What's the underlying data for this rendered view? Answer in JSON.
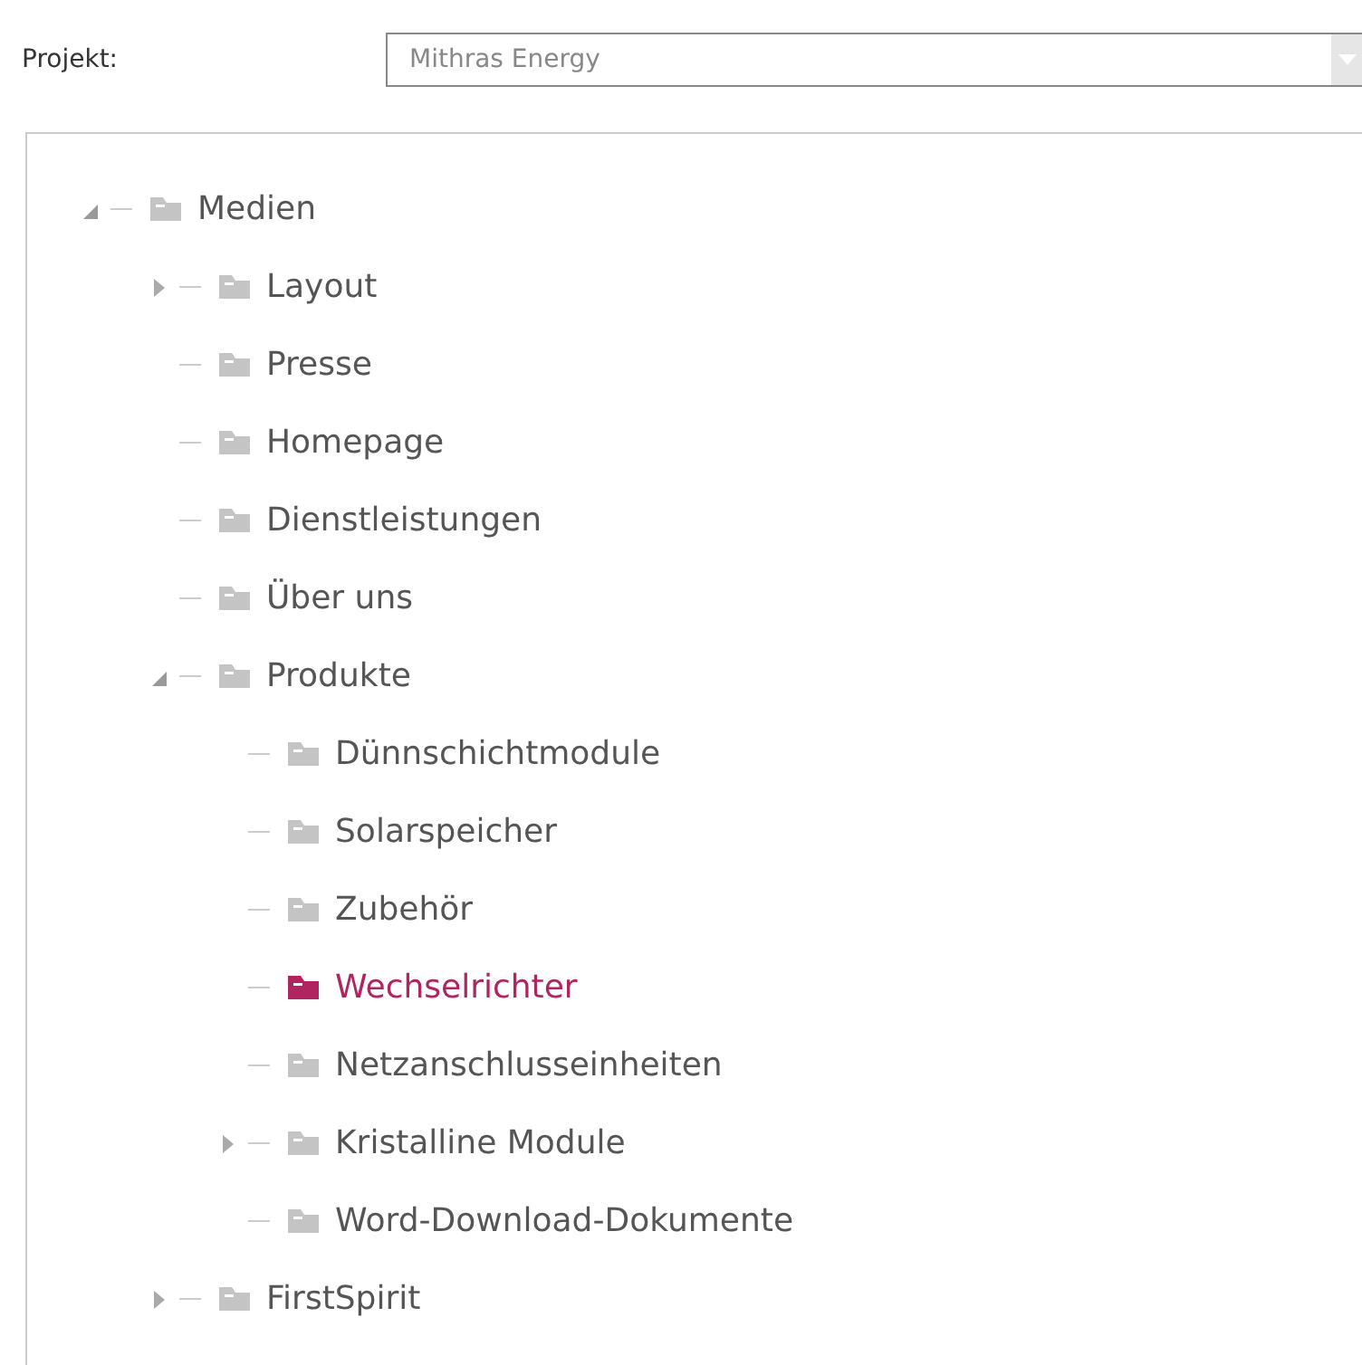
{
  "project": {
    "label": "Projekt:",
    "value": "Mithras Energy"
  },
  "tree": [
    {
      "label": "Medien",
      "expanded": true,
      "selected": false,
      "children": [
        {
          "label": "Layout",
          "expanded": false,
          "selected": false
        },
        {
          "label": "Presse",
          "selected": false
        },
        {
          "label": "Homepage",
          "selected": false
        },
        {
          "label": "Dienstleistungen",
          "selected": false
        },
        {
          "label": "Über uns",
          "selected": false
        },
        {
          "label": "Produkte",
          "expanded": true,
          "selected": false,
          "children": [
            {
              "label": "Dünnschichtmodule",
              "selected": false
            },
            {
              "label": "Solarspeicher",
              "selected": false
            },
            {
              "label": "Zubehör",
              "selected": false
            },
            {
              "label": "Wechselrichter",
              "selected": true
            },
            {
              "label": "Netzanschlusseinheiten",
              "selected": false
            },
            {
              "label": "Kristalline Module",
              "expanded": false,
              "selected": false
            },
            {
              "label": "Word-Download-Dokumente",
              "selected": false
            }
          ]
        },
        {
          "label": "FirstSpirit",
          "expanded": false,
          "selected": false
        }
      ]
    }
  ]
}
